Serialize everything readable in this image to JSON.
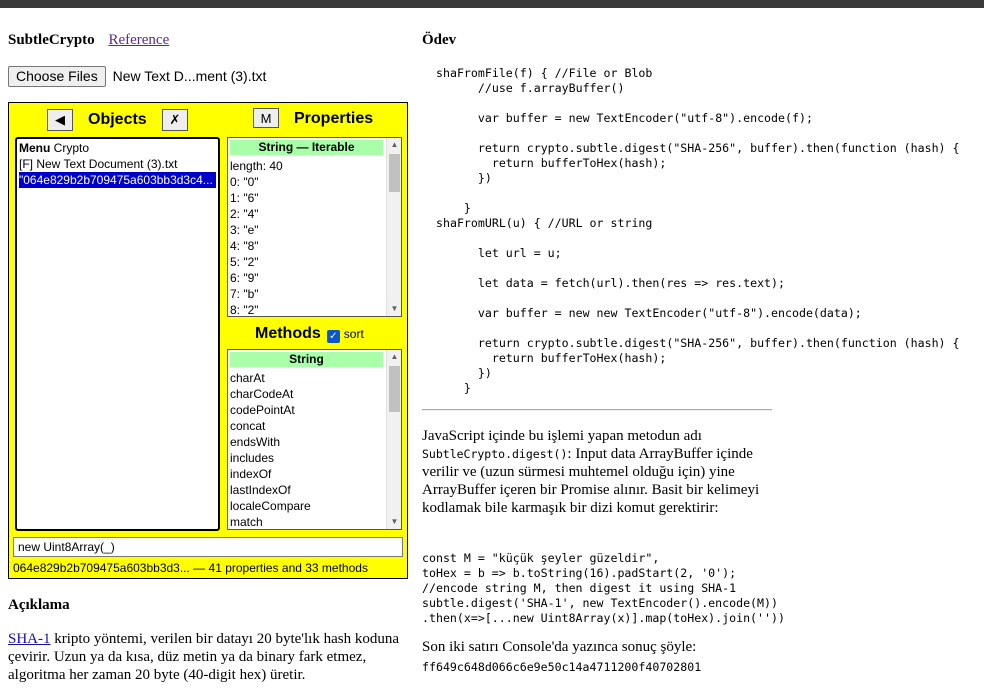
{
  "left": {
    "app_title": "SubtleCrypto",
    "reference_link": "Reference",
    "choose_files_label": "Choose Files",
    "file_name": "New Text D...ment (3).txt"
  },
  "inspector": {
    "back_icon": "◀",
    "objects_title": "Objects",
    "close_icon": "✗",
    "m_button": "M",
    "properties_title": "Properties",
    "objects": [
      {
        "bold": "Menu",
        "rest": " Crypto"
      },
      {
        "bold": "",
        "rest": "[F] New Text Document (3).txt"
      },
      {
        "bold": "",
        "rest": "\"064e829b2b709475a603bb3d3c4..."
      }
    ],
    "properties_header": "String — Iterable",
    "properties": [
      "length: 40",
      "0: \"0\"",
      "1: \"6\"",
      "2: \"4\"",
      "3: \"e\"",
      "4: \"8\"",
      "5: \"2\"",
      "6: \"9\"",
      "7: \"b\"",
      "8: \"2\""
    ],
    "methods_title": "Methods",
    "sort_label": "sort",
    "sort_checked": true,
    "methods_header": "String",
    "methods": [
      "charAt",
      "charCodeAt",
      "codePointAt",
      "concat",
      "endsWith",
      "includes",
      "indexOf",
      "lastIndexOf",
      "localeCompare",
      "match"
    ],
    "command_value": "new Uint8Array(_)",
    "status": "064e829b2b709475a603bb3d3... — 41 properties and 33 methods"
  },
  "aciklama": {
    "heading": "Açıklama",
    "link": "SHA-1",
    "text": " kripto yöntemi, verilen bir datayı 20 byte'lık hash koduna çevirir. Uzun ya da kısa, düz metin ya da binary fark etmez, algoritma her zaman 20 byte (40-digit hex) üretir."
  },
  "odev": {
    "heading": "Ödev",
    "code": "shaFromFile(f) { //File or Blob\n      //use f.arrayBuffer()\n\n      var buffer = new TextEncoder(\"utf-8\").encode(f);\n\n      return crypto.subtle.digest(\"SHA-256\", buffer).then(function (hash) {\n        return bufferToHex(hash);\n      })\n\n    }\nshaFromURL(u) { //URL or string\n\n      let url = u;\n\n      let data = fetch(url).then(res => res.text);\n\n      var buffer = new new TextEncoder(\"utf-8\").encode(data);\n\n      return crypto.subtle.digest(\"SHA-256\", buffer).then(function (hash) {\n        return bufferToHex(hash);\n      })\n    }",
    "para_before": "JavaScript içinde bu işlemi yapan metodun adı ",
    "para_code": "SubtleCrypto.digest()",
    "para_after": ": Input data ArrayBuffer içinde verilir ve (uzun sürmesi muhtemel olduğu için) yine ArrayBuffer içeren bir Promise alınır. Basit bir kelimeyi kodlamak bile karmaşık bir dizi komut gerektirir:",
    "code2": "const M = \"küçük şeyler güzeldir\",\ntoHex = b => b.toString(16).padStart(2, '0');\n//encode string M, then digest it using SHA-1\nsubtle.digest('SHA-1', new TextEncoder().encode(M))\n.then(x=>[...new Uint8Array(x)].map(toHex).join(''))",
    "result_label": "Son iki satırı Console'da yazınca sonuç şöyle:",
    "result_value": "ff649c648d066c6e9e50c14a4711200f40702801"
  }
}
